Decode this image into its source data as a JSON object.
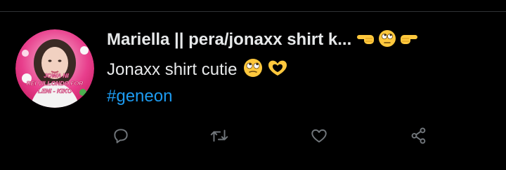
{
  "tweet": {
    "author": {
      "display_name": "Mariella || pera/jonaxx shirt k...",
      "avatar_caption_lines": [
        "JOWA NI",
        "REI VILLONDO FOR",
        "LENI - KIKO"
      ]
    },
    "name_emojis": [
      "backhand-index-pointing-left-icon",
      "rolling-eyes-emoji-icon",
      "backhand-index-pointing-right-icon"
    ],
    "text": "Jonaxx shirt cutie",
    "text_emojis": [
      "face-with-rolling-eyes-icon",
      "heart-hands-icon"
    ],
    "hashtag": "#geneon",
    "actions": [
      {
        "name": "reply",
        "icon": "reply-icon"
      },
      {
        "name": "retweet",
        "icon": "retweet-icon"
      },
      {
        "name": "like",
        "icon": "heart-icon"
      },
      {
        "name": "share",
        "icon": "share-icon"
      }
    ]
  },
  "colors": {
    "background": "#000000",
    "text": "#e7e9ea",
    "hashtag": "#1d9bf0",
    "icon": "#71767b",
    "divider": "#2f3336"
  }
}
